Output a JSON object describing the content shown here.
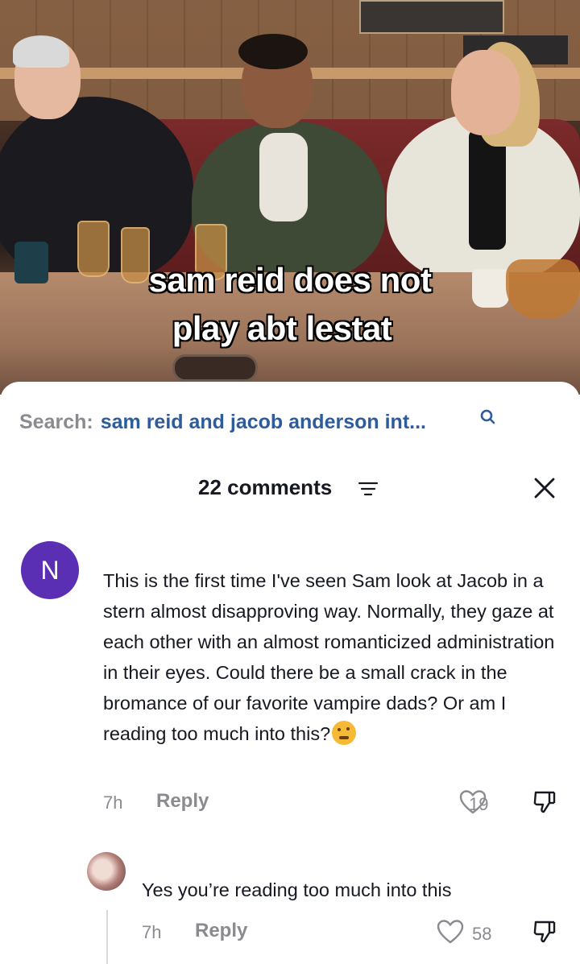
{
  "video": {
    "caption_line1": "sam reid does not",
    "caption_line2": "play abt lestat"
  },
  "search": {
    "prefix": "Search:",
    "query": "sam reid and jacob anderson int..."
  },
  "comments_header": {
    "count_label": "22 comments"
  },
  "comments": [
    {
      "avatar_letter": "N",
      "text": "This is the first time I've seen Sam look at Jacob in a stern almost disapproving way. Normally, they gaze at each other with an almost romanticized administration in their eyes. Could there be a small crack in the bromance of our favorite vampire dads? Or am I reading too much into this?",
      "emoji": "thinking-face",
      "time": "7h",
      "reply_label": "Reply",
      "likes": "19"
    }
  ],
  "replies": [
    {
      "text": "Yes you’re reading too much into this",
      "time": "7h",
      "reply_label": "Reply",
      "likes": "58"
    }
  ],
  "colors": {
    "search_query": "#2e5b9b",
    "avatar_n": "#5a2fb3",
    "muted": "#8a8b91"
  }
}
